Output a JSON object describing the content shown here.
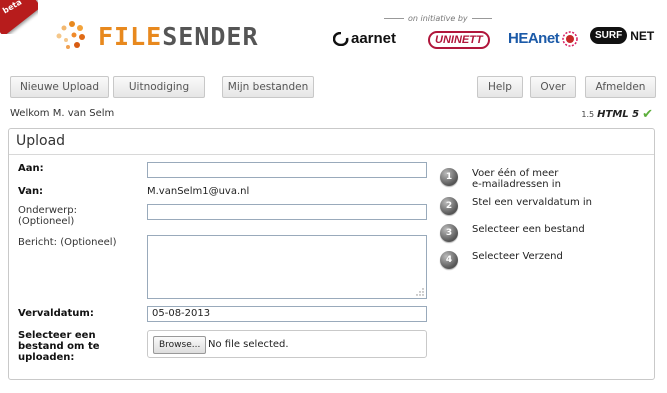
{
  "badge": {
    "beta": "beta"
  },
  "header": {
    "logo_part1": "FILE",
    "logo_part2": "SENDER",
    "initiative": "on initiative by",
    "partners": {
      "aarnet": "aarnet",
      "uninett": "UNINETT",
      "heanet": "HEAnet",
      "surf": "SURF",
      "net": "NET"
    }
  },
  "nav": {
    "new_upload": "Nieuwe Upload",
    "invitation": "Uitnodiging",
    "my_files": "Mijn bestanden",
    "help": "Help",
    "about": "Over",
    "logout": "Afmelden"
  },
  "welcome": "Welkom M. van Selm",
  "version": {
    "number": "1.5",
    "html": "HTML",
    "five": "5",
    "check": "✔"
  },
  "panel": {
    "title": "Upload",
    "to_label": "Aan:",
    "to_value": "",
    "from_label": "Van:",
    "from_value": "M.vanSelm1@uva.nl",
    "subject_label_1": "Onderwerp:",
    "subject_label_2": "(Optioneel)",
    "subject_value": "",
    "message_label": "Bericht: (Optioneel)",
    "message_value": "",
    "expiry_label": "Vervaldatum:",
    "expiry_value": "05-08-2013",
    "file_label_1": "Selecteer een",
    "file_label_2": "bestand om te",
    "file_label_3": "uploaden:",
    "browse_label": "Browse...",
    "no_file": "No file selected."
  },
  "steps": [
    {
      "num": "1",
      "line1": "Voer één of meer",
      "line2": "e-mailadressen in"
    },
    {
      "num": "2",
      "line1": "Stel een vervaldatum in",
      "line2": ""
    },
    {
      "num": "3",
      "line1": "Selecteer een bestand",
      "line2": ""
    },
    {
      "num": "4",
      "line1": "Selecteer Verzend",
      "line2": ""
    }
  ]
}
